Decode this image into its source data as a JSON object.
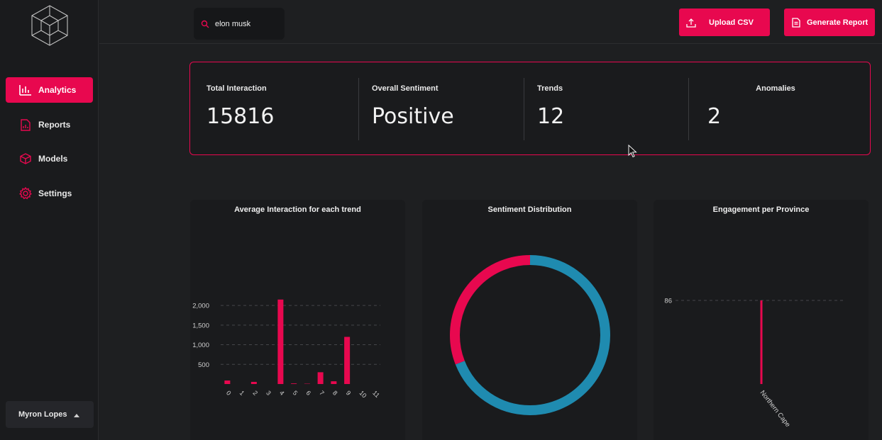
{
  "sidebar": {
    "items": [
      {
        "label": "Analytics",
        "icon": "bar-chart-icon",
        "active": true
      },
      {
        "label": "Reports",
        "icon": "document-chart-icon",
        "active": false
      },
      {
        "label": "Models",
        "icon": "cube-icon",
        "active": false
      },
      {
        "label": "Settings",
        "icon": "gear-icon",
        "active": false
      }
    ],
    "user_name": "Myron Lopes"
  },
  "header": {
    "search_value": "elon musk",
    "upload_label": "Upload CSV",
    "report_label": "Generate Report"
  },
  "stats": [
    {
      "label": "Total Interaction",
      "value": "15816"
    },
    {
      "label": "Overall Sentiment",
      "value": "Positive"
    },
    {
      "label": "Trends",
      "value": "12"
    },
    {
      "label": "Anomalies",
      "value": "2"
    }
  ],
  "colors": {
    "accent": "#e8084f",
    "positive": "#1f8bb0",
    "background": "#1e1f21"
  },
  "charts": {
    "avg_title": "Average Interaction for each trend",
    "sentiment_title": "Sentiment Distribution",
    "province_title": "Engagement per Province"
  },
  "chart_data": [
    {
      "type": "bar",
      "title": "Average Interaction for each trend",
      "categories": [
        "0",
        "1",
        "2",
        "3",
        "4",
        "5",
        "6",
        "7",
        "8",
        "9",
        "10",
        "11"
      ],
      "values": [
        90,
        0,
        55,
        0,
        2150,
        15,
        8,
        300,
        70,
        1200,
        0,
        0
      ],
      "yticks": [
        500,
        1000,
        1500,
        2000
      ],
      "yticklabels": [
        "500",
        "1,000",
        "1,500",
        "2,000"
      ],
      "ylim": [
        0,
        2200
      ]
    },
    {
      "type": "pie",
      "title": "Sentiment Distribution",
      "values": [
        0.69,
        0.31
      ],
      "colors": [
        "#1f8bb0",
        "#e8084f"
      ]
    },
    {
      "type": "bar",
      "title": "Engagement per Province",
      "categories": [
        "Northern Cape"
      ],
      "values": [
        86
      ],
      "yticks": [
        86
      ],
      "yticklabels": [
        "86"
      ],
      "ylim": [
        0,
        86
      ]
    }
  ]
}
